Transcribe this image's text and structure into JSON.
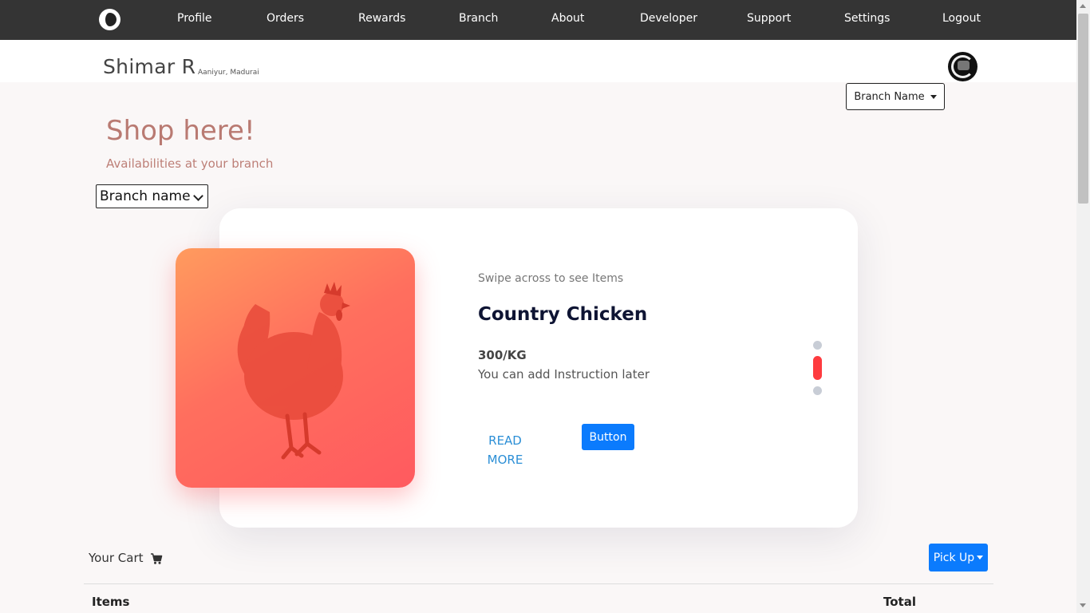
{
  "nav": {
    "items": [
      "Profile",
      "Orders",
      "Rewards",
      "Branch",
      "About",
      "Developer",
      "Support",
      "Settings",
      "Logout"
    ]
  },
  "header": {
    "username": "Shimar R",
    "location": "Aaniyur, Madurai",
    "branch_dropdown": "Branch Name"
  },
  "hero": {
    "title": "Shop here!",
    "subtitle": "Availabilities at your branch",
    "branch_select": "Branch name"
  },
  "product": {
    "swipe_hint": "Swipe across to see Items",
    "name": "Country Chicken",
    "price": "300/KG",
    "note": "You can add Instruction later",
    "read_more_label": "READ MORE",
    "button_label": "Button",
    "slides_total": 3,
    "active_slide": 2
  },
  "cart": {
    "label": "Your Cart",
    "pickup_label": "Pick Up",
    "col_items": "Items",
    "col_total": "Total"
  },
  "colors": {
    "nav_bg": "#343434",
    "accent_blue": "#0b7bfd",
    "title_rose": "#b97a72",
    "active_dot": "#fe3b3f",
    "image_gradient_start": "#ff9b5e",
    "image_gradient_end": "#ff5a5f"
  }
}
